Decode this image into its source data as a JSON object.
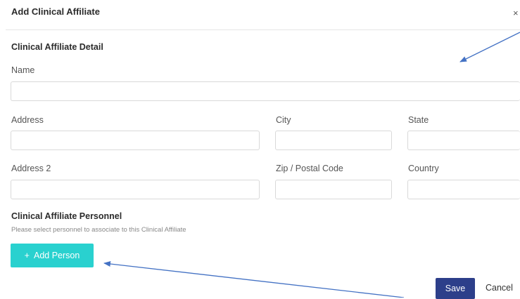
{
  "modal": {
    "title": "Add Clinical Affiliate",
    "close_glyph": "×"
  },
  "detail": {
    "heading": "Clinical Affiliate Detail",
    "name_label": "Name",
    "name_value": "",
    "address_label": "Address",
    "address_value": "",
    "city_label": "City",
    "city_value": "",
    "state_label": "State",
    "state_value": "",
    "address2_label": "Address 2",
    "address2_value": "",
    "zip_label": "Zip / Postal Code",
    "zip_value": "",
    "country_label": "Country",
    "country_value": ""
  },
  "personnel": {
    "heading": "Clinical Affiliate Personnel",
    "hint": "Please select personnel to associate to this Clinical Affiliate",
    "add_icon": "+",
    "add_label": "Add Person"
  },
  "footer": {
    "save_label": "Save",
    "cancel_label": "Cancel"
  },
  "colors": {
    "add_button": "#29d1cf",
    "save_button": "#2d3f8a",
    "annotation_arrow": "#4472c4"
  }
}
